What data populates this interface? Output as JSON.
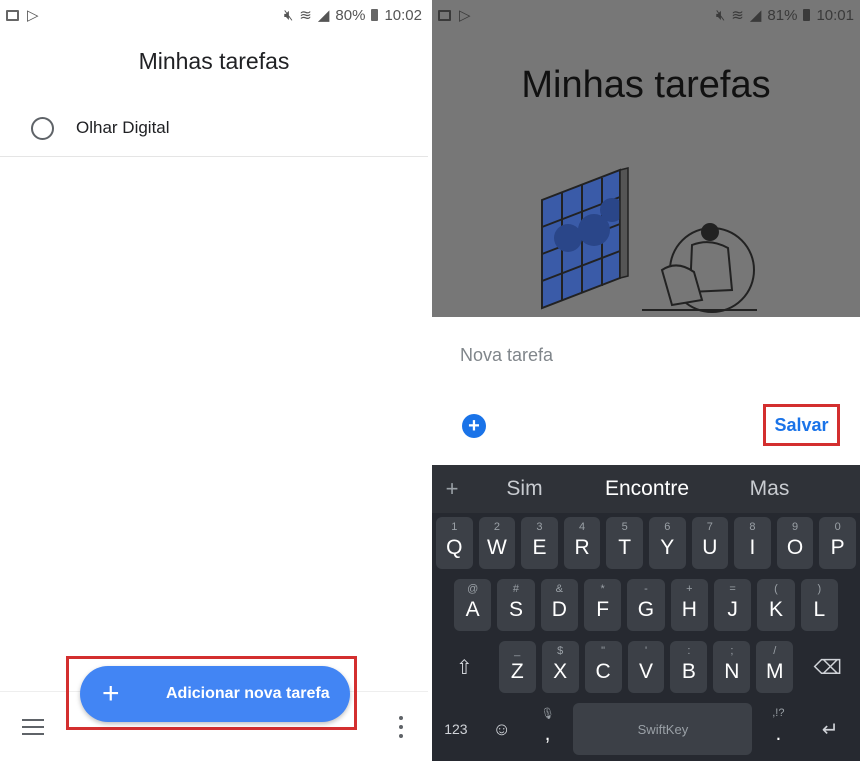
{
  "left": {
    "status": {
      "battery": "80%",
      "time": "10:02"
    },
    "title": "Minhas tarefas",
    "tasks": [
      {
        "label": "Olhar Digital"
      }
    ],
    "fab": {
      "label": "Adicionar nova tarefa",
      "icon": "plus-icon"
    },
    "bottom_bar": {
      "menu_icon": "menu-icon",
      "more_icon": "more-vert-icon"
    }
  },
  "right": {
    "status": {
      "battery": "81%",
      "time": "10:01"
    },
    "title": "Minhas tarefas",
    "sheet": {
      "placeholder": "Nova tarefa",
      "add_icon": "+",
      "save_label": "Salvar"
    },
    "keyboard": {
      "suggestions": [
        "Sim",
        "Encontre",
        "Mas"
      ],
      "row1": [
        {
          "main": "Q",
          "sub": "1"
        },
        {
          "main": "W",
          "sub": "2"
        },
        {
          "main": "E",
          "sub": "3"
        },
        {
          "main": "R",
          "sub": "4"
        },
        {
          "main": "T",
          "sub": "5"
        },
        {
          "main": "Y",
          "sub": "6"
        },
        {
          "main": "U",
          "sub": "7"
        },
        {
          "main": "I",
          "sub": "8"
        },
        {
          "main": "O",
          "sub": "9"
        },
        {
          "main": "P",
          "sub": "0"
        }
      ],
      "row2": [
        {
          "main": "A",
          "sub": "@"
        },
        {
          "main": "S",
          "sub": "#"
        },
        {
          "main": "D",
          "sub": "&"
        },
        {
          "main": "F",
          "sub": "*"
        },
        {
          "main": "G",
          "sub": "-"
        },
        {
          "main": "H",
          "sub": "+"
        },
        {
          "main": "J",
          "sub": "="
        },
        {
          "main": "K",
          "sub": "("
        },
        {
          "main": "L",
          "sub": ")"
        }
      ],
      "row3": [
        {
          "main": "Z",
          "sub": "_"
        },
        {
          "main": "X",
          "sub": "$"
        },
        {
          "main": "C",
          "sub": "\""
        },
        {
          "main": "V",
          "sub": "'"
        },
        {
          "main": "B",
          "sub": ":"
        },
        {
          "main": "N",
          "sub": ";"
        },
        {
          "main": "M",
          "sub": "/"
        }
      ],
      "bottom": {
        "num": "123",
        "space": "SwiftKey",
        "comma": ",",
        "period": "."
      }
    }
  },
  "colors": {
    "accent": "#4285f4",
    "link": "#1a73e8",
    "highlight": "#d32f2f"
  }
}
